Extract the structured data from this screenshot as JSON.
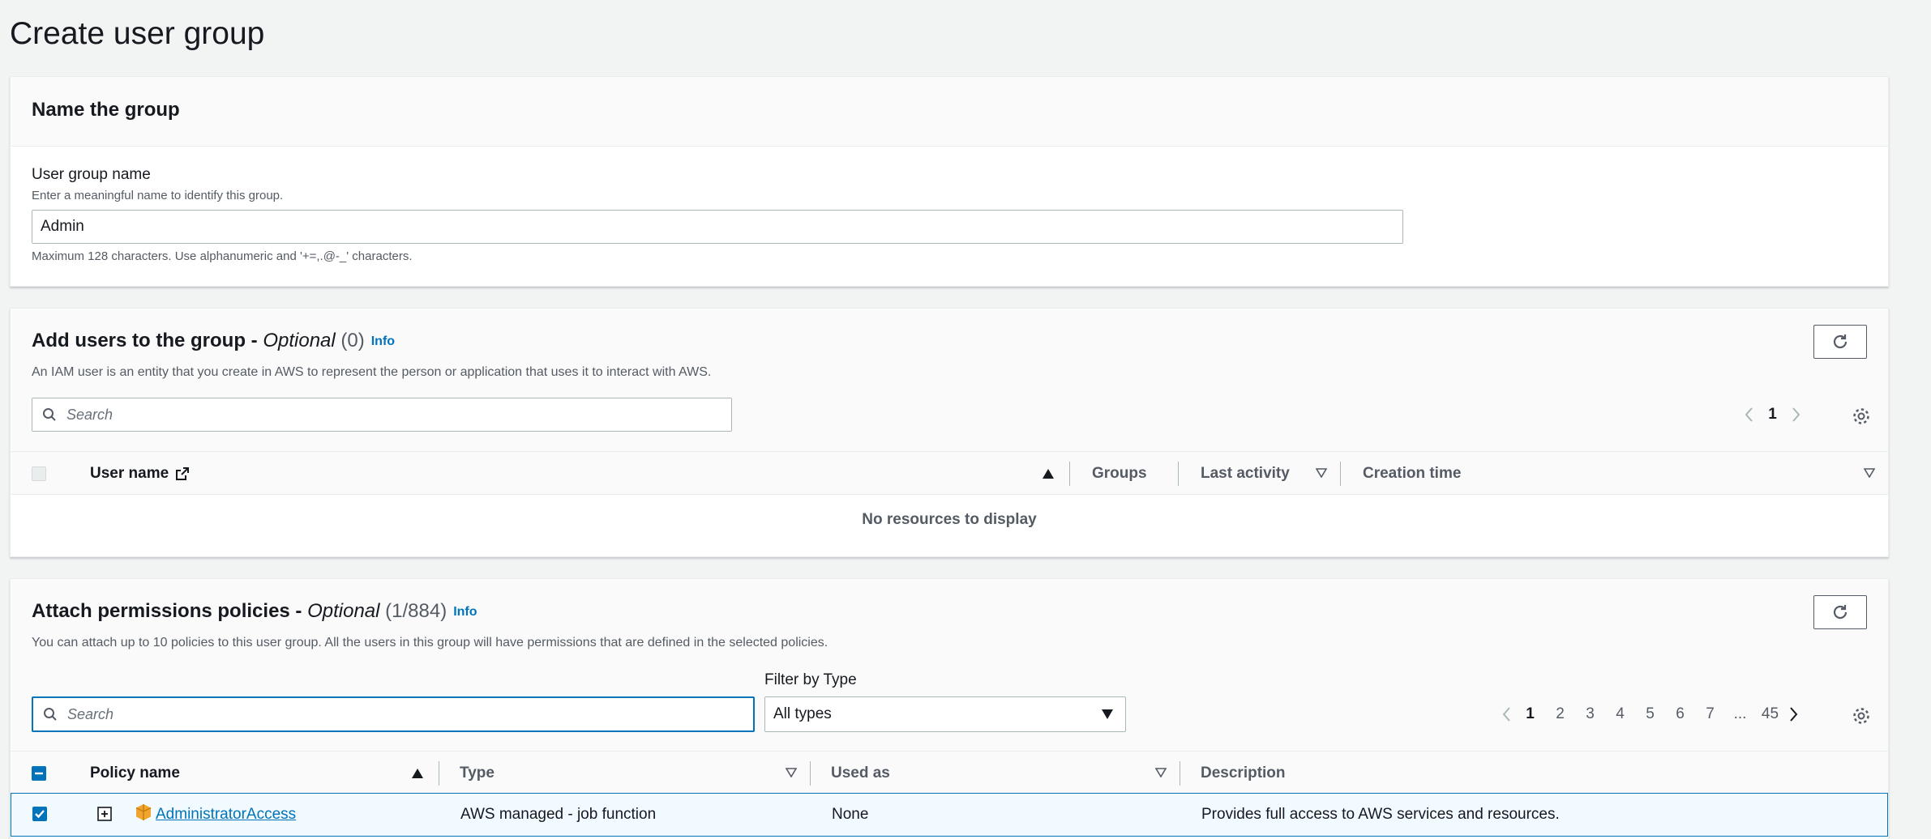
{
  "page_title": "Create user group",
  "name_section": {
    "title": "Name the group",
    "field_label": "User group name",
    "field_hint": "Enter a meaningful name to identify this group.",
    "field_value": "Admin",
    "constraint": "Maximum 128 characters. Use alphanumeric and '+=,.@-_' characters."
  },
  "users_section": {
    "title": "Add users to the group - ",
    "optional": "Optional",
    "count": "(0)",
    "info": "Info",
    "description": "An IAM user is an entity that you create in AWS to represent the person or application that uses it to interact with AWS.",
    "search_placeholder": "Search",
    "current_page": "1",
    "columns": [
      "User name",
      "Groups",
      "Last activity",
      "Creation time"
    ],
    "empty_text": "No resources to display"
  },
  "policies_section": {
    "title": "Attach permissions policies - ",
    "optional": "Optional",
    "count": "(1/884)",
    "info": "Info",
    "description": "You can attach up to 10 policies to this user group. All the users in this group will have permissions that are defined in the selected policies.",
    "search_placeholder": "Search",
    "filter_label": "Filter by Type",
    "filter_value": "All types",
    "pages": [
      "1",
      "2",
      "3",
      "4",
      "5",
      "6",
      "7",
      "...",
      "45"
    ],
    "current_page": "1",
    "columns": [
      "Policy name",
      "Type",
      "Used as",
      "Description"
    ],
    "rows": [
      {
        "selected": true,
        "name": "AdministratorAccess",
        "type": "AWS managed - job function",
        "used_as": "None",
        "description": "Provides full access to AWS services and resources."
      }
    ]
  },
  "colors": {
    "link": "#0073bb",
    "checkbox": "#0073bb",
    "text": "#16191f",
    "muted": "#545b64"
  }
}
